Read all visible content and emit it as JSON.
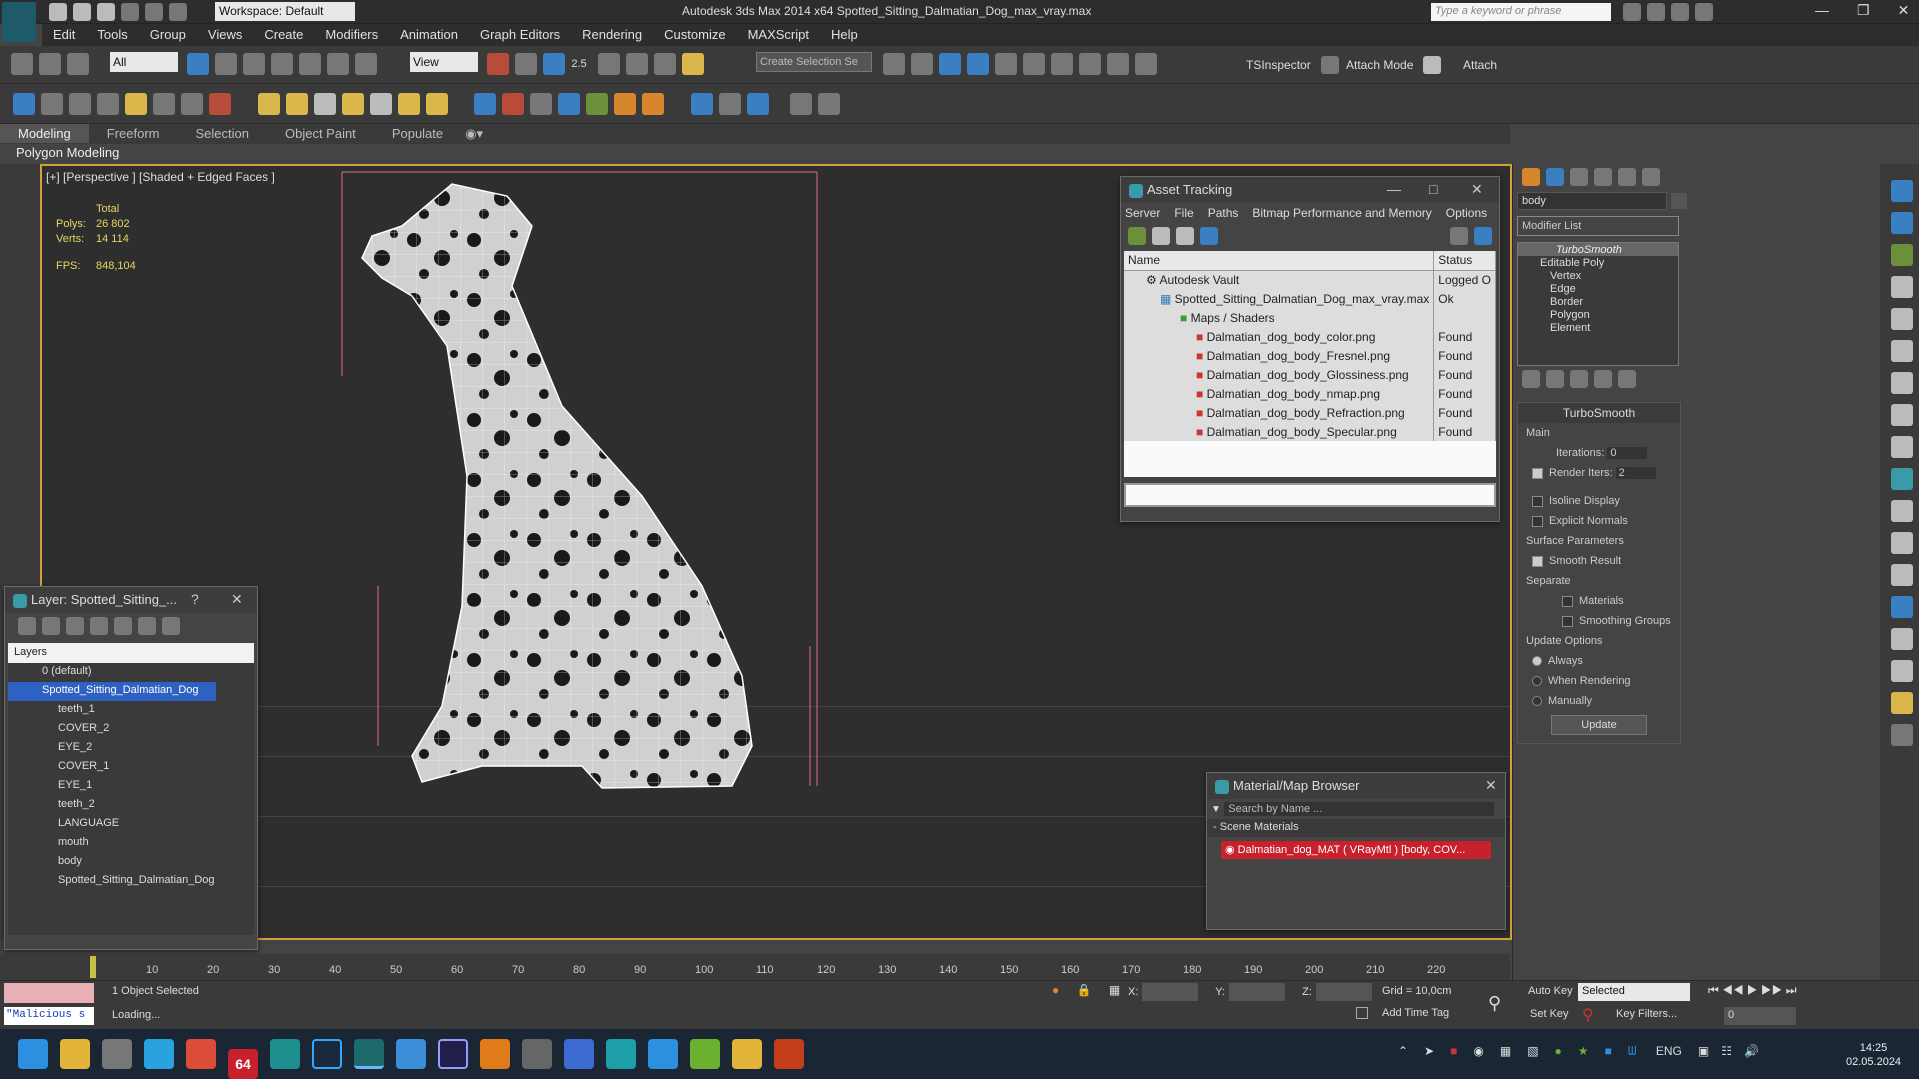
{
  "app": {
    "title": "Autodesk 3ds Max  2014 x64    Spotted_Sitting_Dalmatian_Dog_max_vray.max",
    "workspace": "Workspace: Default",
    "search_placeholder": "Type a keyword or phrase"
  },
  "menu": [
    "Edit",
    "Tools",
    "Group",
    "Views",
    "Create",
    "Modifiers",
    "Animation",
    "Graph Editors",
    "Rendering",
    "Customize",
    "MAXScript",
    "Help"
  ],
  "toolbar": {
    "selection_filter": "All",
    "ref_coord": "View",
    "snap_label": "2.5",
    "create_selection_set": "Create Selection Se",
    "tsinspector": "TSInspector",
    "attach_mode": "Attach Mode",
    "attach": "Attach"
  },
  "ribbon": {
    "tabs": [
      "Modeling",
      "Freeform",
      "Selection",
      "Object Paint",
      "Populate"
    ],
    "active": "Modeling",
    "subtitle": "Polygon Modeling"
  },
  "viewport": {
    "label": "[+] [Perspective ] [Shaded + Edged Faces ]",
    "stats": {
      "total_label": "Total",
      "polys_label": "Polys:",
      "polys": "26 802",
      "verts_label": "Verts:",
      "verts": "14 114",
      "fps_label": "FPS:",
      "fps": "848,104"
    }
  },
  "asset_tracking": {
    "title": "Asset Tracking",
    "menu": [
      "Server",
      "File",
      "Paths",
      "Bitmap Performance and Memory",
      "Options"
    ],
    "col_name": "Name",
    "col_status": "Status",
    "rows": [
      {
        "name": "Autodesk Vault",
        "status": "Logged O"
      },
      {
        "name": "Spotted_Sitting_Dalmatian_Dog_max_vray.max",
        "status": "Ok"
      },
      {
        "name": "Maps / Shaders",
        "status": ""
      },
      {
        "name": "Dalmatian_dog_body_color.png",
        "status": "Found"
      },
      {
        "name": "Dalmatian_dog_body_Fresnel.png",
        "status": "Found"
      },
      {
        "name": "Dalmatian_dog_body_Glossiness.png",
        "status": "Found"
      },
      {
        "name": "Dalmatian_dog_body_nmap.png",
        "status": "Found"
      },
      {
        "name": "Dalmatian_dog_body_Refraction.png",
        "status": "Found"
      },
      {
        "name": "Dalmatian_dog_body_Specular.png",
        "status": "Found"
      }
    ]
  },
  "layer_window": {
    "title": "Layer: Spotted_Sitting_...",
    "header": "Layers",
    "items": [
      "0 (default)",
      "Spotted_Sitting_Dalmatian_Dog",
      "teeth_1",
      "COVER_2",
      "EYE_2",
      "COVER_1",
      "EYE_1",
      "teeth_2",
      "LANGUAGE",
      "mouth",
      "body",
      "Spotted_Sitting_Dalmatian_Dog"
    ]
  },
  "material_browser": {
    "title": "Material/Map Browser",
    "search_placeholder": "Search by Name ...",
    "section": "Scene Materials",
    "material": "Dalmatian_dog_MAT  ( VRayMtl ) [body, COV..."
  },
  "command_panel": {
    "object_name": "body",
    "modifier_list": "Modifier List",
    "stack": [
      "TurboSmooth",
      "Editable Poly",
      "Vertex",
      "Edge",
      "Border",
      "Polygon",
      "Element"
    ],
    "rollout_title": "TurboSmooth",
    "main": "Main",
    "iterations_label": "Iterations:",
    "iterations": "0",
    "render_iters_label": "Render Iters:",
    "render_iters": "2",
    "isoline": "Isoline Display",
    "explicit_normals": "Explicit Normals",
    "surface_params": "Surface Parameters",
    "smooth_result": "Smooth Result",
    "separate": "Separate",
    "materials": "Materials",
    "smoothing_groups": "Smoothing Groups",
    "update_options": "Update Options",
    "always": "Always",
    "when_rendering": "When Rendering",
    "manually": "Manually",
    "update_button": "Update"
  },
  "timeline": {
    "ticks": [
      "10",
      "20",
      "30",
      "40",
      "50",
      "60",
      "70",
      "80",
      "90",
      "100",
      "110",
      "120",
      "130",
      "140",
      "150",
      "160",
      "170",
      "180",
      "190",
      "200",
      "210",
      "220"
    ]
  },
  "status": {
    "maxscript": "\"Malicious s",
    "selected": "1 Object Selected",
    "loading": "Loading...",
    "x_label": "X:",
    "y_label": "Y:",
    "z_label": "Z:",
    "grid": "Grid = 10,0cm",
    "add_time_tag": "Add Time Tag",
    "auto_key": "Auto Key",
    "set_key": "Set Key",
    "key_mode": "Selected",
    "key_filters": "Key Filters...",
    "frame": "0"
  },
  "taskbar": {
    "lang": "ENG",
    "time": "14:25",
    "date": "02.05.2024",
    "badge": "64"
  }
}
